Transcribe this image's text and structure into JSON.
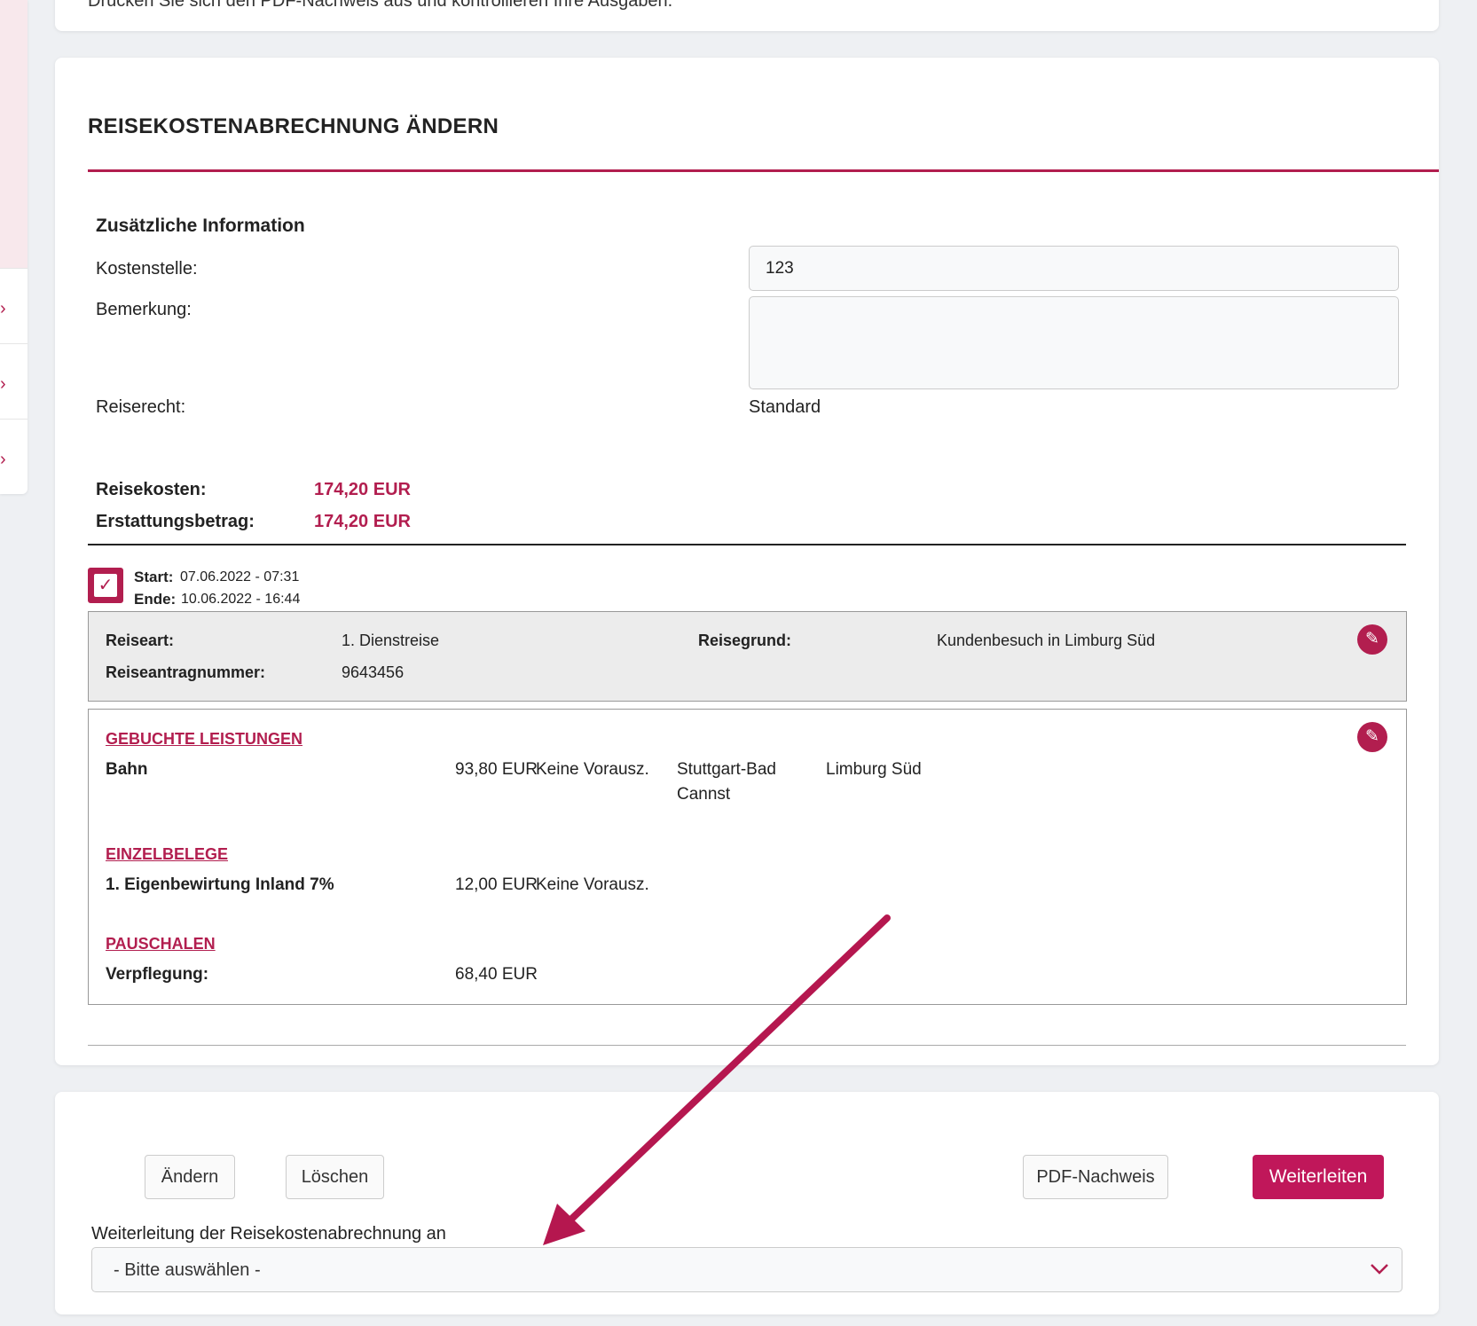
{
  "top_hint": "Drucken Sie sich den PDF-Nachweis aus und kontrollieren Ihre Ausgaben.",
  "page_title": "REISEKOSTENABRECHNUNG ÄNDERN",
  "info": {
    "heading": "Zusätzliche Information",
    "kostenstelle_label": "Kostenstelle:",
    "kostenstelle_value": "123",
    "bemerkung_label": "Bemerkung:",
    "bemerkung_value": "",
    "reiserecht_label": "Reiserecht:",
    "reiserecht_value": "Standard"
  },
  "summary": {
    "reisekosten_label": "Reisekosten:",
    "reisekosten_value": "174,20 EUR",
    "erstattung_label": "Erstattungsbetrag:",
    "erstattung_value": "174,20 EUR"
  },
  "trip": {
    "start_label": "Start:",
    "start_value": "07.06.2022 - 07:31",
    "end_label": "Ende:",
    "end_value": "10.06.2022 - 16:44",
    "reiseart_label": "Reiseart:",
    "reiseart_value": "1. Dienstreise",
    "reisegrund_label": "Reisegrund:",
    "reisegrund_value": "Kundenbesuch in Limburg Süd",
    "antragnummer_label": "Reiseantragnummer:",
    "antragnummer_value": "9643456"
  },
  "details": {
    "gebuchte_heading": "GEBUCHTE LEISTUNGEN",
    "bahn_label": "Bahn",
    "bahn_amount": "93,80 EUR",
    "bahn_vorausz": "Keine Vorausz.",
    "bahn_from_1": "Stuttgart-Bad",
    "bahn_from_2": "Cannst",
    "bahn_to": "Limburg Süd",
    "einzelbelege_heading": "EINZELBELEGE",
    "beleg_label": "1.  Eigenbewirtung Inland 7%",
    "beleg_amount": "12,00 EUR",
    "beleg_vorausz": "Keine Vorausz.",
    "pauschalen_heading": "PAUSCHALEN",
    "verpflegung_label": "Verpflegung:",
    "verpflegung_amount": "68,40 EUR"
  },
  "actions": {
    "aendern": "Ändern",
    "loeschen": "Löschen",
    "pdf": "PDF-Nachweis",
    "weiterleiten": "Weiterleiten",
    "forward_label": "Weiterleitung der Reisekostenabrechnung an",
    "forward_selected": "- Bitte auswählen -"
  },
  "colors": {
    "accent": "#b21e4f",
    "primary_button": "#c0175a",
    "arrow": "#b5174f"
  },
  "icons": {
    "sidebar_chevrons": [
      "chevron-right-icon",
      "chevron-right-icon",
      "chevron-right-icon"
    ],
    "check": "checkbox-checked-icon",
    "edit": "edit-icon",
    "select_caret": "chevron-down-icon"
  }
}
